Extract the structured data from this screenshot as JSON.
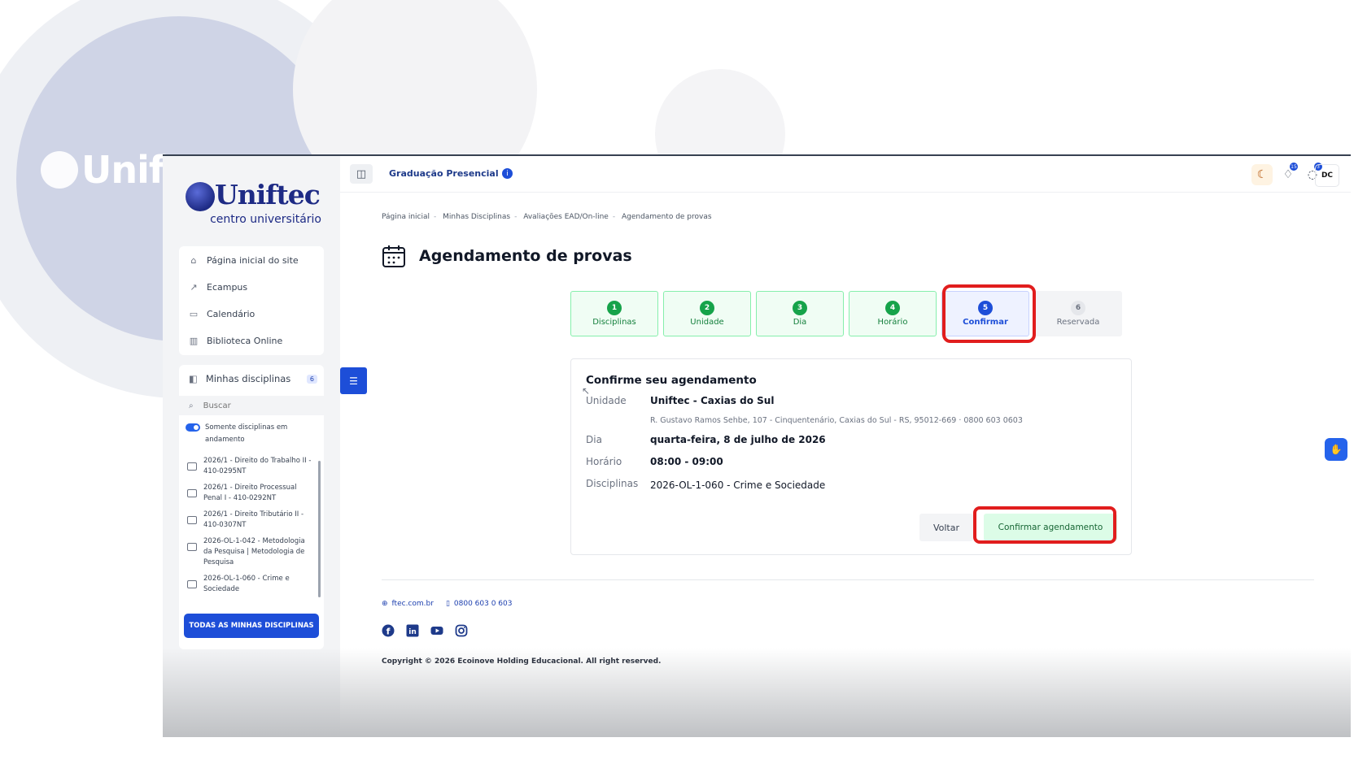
{
  "background": {
    "brand_text": "Unift"
  },
  "brand": {
    "name": "Uniftec",
    "tagline": "centro universitário"
  },
  "sidebar": {
    "links": [
      {
        "icon": "home-icon",
        "label": "Página inicial do site"
      },
      {
        "icon": "external-link-icon",
        "label": "Ecampus"
      },
      {
        "icon": "calendar-icon",
        "label": "Calendário"
      },
      {
        "icon": "library-icon",
        "label": "Biblioteca Online"
      }
    ],
    "disciplines": {
      "title": "Minhas disciplinas",
      "count": "6",
      "search_placeholder": "Buscar",
      "toggle_label": "Somente disciplinas em andamento",
      "items": [
        "2026/1 - Direito do Trabalho II - 410-0295NT",
        "2026/1 - Direito Processual Penal I - 410-0292NT",
        "2026/1 - Direito Tributário II - 410-0307NT",
        "2026-OL-1-042 - Metodologia da Pesquisa | Metodologia de Pesquisa",
        "2026-OL-1-060 - Crime e Sociedade"
      ],
      "all_button": "TODAS AS MINHAS DISCIPLINAS"
    }
  },
  "topbar": {
    "title": "Graduação Presencial",
    "info": "i",
    "notifications_count": "15",
    "messages_count": "3",
    "user_initials": "DC"
  },
  "breadcrumb": [
    "Página inicial",
    "Minhas Disciplinas",
    "Avaliações EAD/On-line",
    "Agendamento de provas"
  ],
  "page_title": "Agendamento de provas",
  "steps": [
    {
      "num": "1",
      "label": "Disciplinas",
      "state": "done"
    },
    {
      "num": "2",
      "label": "Unidade",
      "state": "done"
    },
    {
      "num": "3",
      "label": "Dia",
      "state": "done"
    },
    {
      "num": "4",
      "label": "Horário",
      "state": "done"
    },
    {
      "num": "5",
      "label": "Confirmar",
      "state": "active"
    },
    {
      "num": "6",
      "label": "Reservada",
      "state": "pending"
    }
  ],
  "confirm": {
    "title": "Confirme seu agendamento",
    "unit_label": "Unidade",
    "unit_value": "Uniftec - Caxias do Sul",
    "unit_address": "R. Gustavo Ramos Sehbe, 107 - Cinquentenário, Caxias do Sul - RS, 95012-669 · 0800 603 0603",
    "day_label": "Dia",
    "day_value": "quarta-feira, 8 de julho de 2026",
    "time_label": "Horário",
    "time_value": "08:00 - 09:00",
    "disc_label": "Disciplinas",
    "disc_value": "2026-OL-1-060 - Crime e Sociedade",
    "back_button": "Voltar",
    "confirm_button": "Confirmar agendamento"
  },
  "footer": {
    "website": "ftec.com.br",
    "phone": "0800 603 0 603",
    "copyright": "Copyright © 2026 Ecoinove Holding Educacional. All right reserved."
  },
  "colors": {
    "primary": "#1d4ed8",
    "success": "#16a34a",
    "highlight": "#e11d1d"
  }
}
